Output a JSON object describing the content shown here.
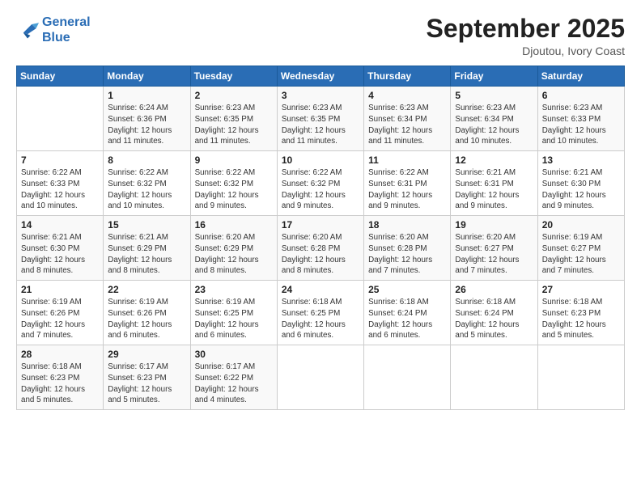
{
  "logo": {
    "line1": "General",
    "line2": "Blue"
  },
  "header": {
    "month": "September 2025",
    "location": "Djoutou, Ivory Coast"
  },
  "weekdays": [
    "Sunday",
    "Monday",
    "Tuesday",
    "Wednesday",
    "Thursday",
    "Friday",
    "Saturday"
  ],
  "weeks": [
    [
      {
        "day": "",
        "info": ""
      },
      {
        "day": "1",
        "info": "Sunrise: 6:24 AM\nSunset: 6:36 PM\nDaylight: 12 hours\nand 11 minutes."
      },
      {
        "day": "2",
        "info": "Sunrise: 6:23 AM\nSunset: 6:35 PM\nDaylight: 12 hours\nand 11 minutes."
      },
      {
        "day": "3",
        "info": "Sunrise: 6:23 AM\nSunset: 6:35 PM\nDaylight: 12 hours\nand 11 minutes."
      },
      {
        "day": "4",
        "info": "Sunrise: 6:23 AM\nSunset: 6:34 PM\nDaylight: 12 hours\nand 11 minutes."
      },
      {
        "day": "5",
        "info": "Sunrise: 6:23 AM\nSunset: 6:34 PM\nDaylight: 12 hours\nand 10 minutes."
      },
      {
        "day": "6",
        "info": "Sunrise: 6:23 AM\nSunset: 6:33 PM\nDaylight: 12 hours\nand 10 minutes."
      }
    ],
    [
      {
        "day": "7",
        "info": "Sunrise: 6:22 AM\nSunset: 6:33 PM\nDaylight: 12 hours\nand 10 minutes."
      },
      {
        "day": "8",
        "info": "Sunrise: 6:22 AM\nSunset: 6:32 PM\nDaylight: 12 hours\nand 10 minutes."
      },
      {
        "day": "9",
        "info": "Sunrise: 6:22 AM\nSunset: 6:32 PM\nDaylight: 12 hours\nand 9 minutes."
      },
      {
        "day": "10",
        "info": "Sunrise: 6:22 AM\nSunset: 6:32 PM\nDaylight: 12 hours\nand 9 minutes."
      },
      {
        "day": "11",
        "info": "Sunrise: 6:22 AM\nSunset: 6:31 PM\nDaylight: 12 hours\nand 9 minutes."
      },
      {
        "day": "12",
        "info": "Sunrise: 6:21 AM\nSunset: 6:31 PM\nDaylight: 12 hours\nand 9 minutes."
      },
      {
        "day": "13",
        "info": "Sunrise: 6:21 AM\nSunset: 6:30 PM\nDaylight: 12 hours\nand 9 minutes."
      }
    ],
    [
      {
        "day": "14",
        "info": "Sunrise: 6:21 AM\nSunset: 6:30 PM\nDaylight: 12 hours\nand 8 minutes."
      },
      {
        "day": "15",
        "info": "Sunrise: 6:21 AM\nSunset: 6:29 PM\nDaylight: 12 hours\nand 8 minutes."
      },
      {
        "day": "16",
        "info": "Sunrise: 6:20 AM\nSunset: 6:29 PM\nDaylight: 12 hours\nand 8 minutes."
      },
      {
        "day": "17",
        "info": "Sunrise: 6:20 AM\nSunset: 6:28 PM\nDaylight: 12 hours\nand 8 minutes."
      },
      {
        "day": "18",
        "info": "Sunrise: 6:20 AM\nSunset: 6:28 PM\nDaylight: 12 hours\nand 7 minutes."
      },
      {
        "day": "19",
        "info": "Sunrise: 6:20 AM\nSunset: 6:27 PM\nDaylight: 12 hours\nand 7 minutes."
      },
      {
        "day": "20",
        "info": "Sunrise: 6:19 AM\nSunset: 6:27 PM\nDaylight: 12 hours\nand 7 minutes."
      }
    ],
    [
      {
        "day": "21",
        "info": "Sunrise: 6:19 AM\nSunset: 6:26 PM\nDaylight: 12 hours\nand 7 minutes."
      },
      {
        "day": "22",
        "info": "Sunrise: 6:19 AM\nSunset: 6:26 PM\nDaylight: 12 hours\nand 6 minutes."
      },
      {
        "day": "23",
        "info": "Sunrise: 6:19 AM\nSunset: 6:25 PM\nDaylight: 12 hours\nand 6 minutes."
      },
      {
        "day": "24",
        "info": "Sunrise: 6:18 AM\nSunset: 6:25 PM\nDaylight: 12 hours\nand 6 minutes."
      },
      {
        "day": "25",
        "info": "Sunrise: 6:18 AM\nSunset: 6:24 PM\nDaylight: 12 hours\nand 6 minutes."
      },
      {
        "day": "26",
        "info": "Sunrise: 6:18 AM\nSunset: 6:24 PM\nDaylight: 12 hours\nand 5 minutes."
      },
      {
        "day": "27",
        "info": "Sunrise: 6:18 AM\nSunset: 6:23 PM\nDaylight: 12 hours\nand 5 minutes."
      }
    ],
    [
      {
        "day": "28",
        "info": "Sunrise: 6:18 AM\nSunset: 6:23 PM\nDaylight: 12 hours\nand 5 minutes."
      },
      {
        "day": "29",
        "info": "Sunrise: 6:17 AM\nSunset: 6:23 PM\nDaylight: 12 hours\nand 5 minutes."
      },
      {
        "day": "30",
        "info": "Sunrise: 6:17 AM\nSunset: 6:22 PM\nDaylight: 12 hours\nand 4 minutes."
      },
      {
        "day": "",
        "info": ""
      },
      {
        "day": "",
        "info": ""
      },
      {
        "day": "",
        "info": ""
      },
      {
        "day": "",
        "info": ""
      }
    ]
  ]
}
